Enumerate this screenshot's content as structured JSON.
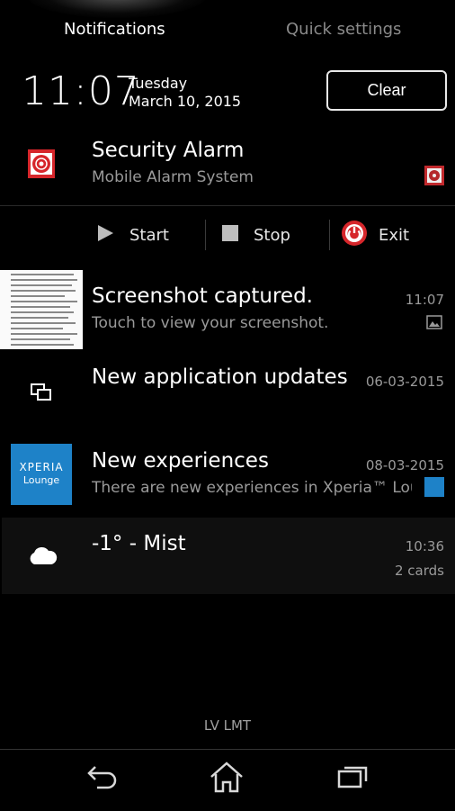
{
  "tabs": {
    "notifications": "Notifications",
    "quick_settings": "Quick settings"
  },
  "header": {
    "time": "11:07",
    "day": "Tuesday",
    "date": "March 10, 2015",
    "clear_label": "Clear"
  },
  "notifications": [
    {
      "title": "Security Alarm",
      "subtitle": "Mobile Alarm System",
      "icon": "alarm-icon"
    },
    {
      "title": "Screenshot captured.",
      "subtitle": "Touch to view your screenshot.",
      "time": "11:07",
      "icon": "screenshot-thumbnail"
    },
    {
      "title": "New application updates",
      "time": "06-03-2015",
      "icon": "updates-icon"
    },
    {
      "title": "New experiences",
      "subtitle": "There are new experiences in Xperia™ Lounge",
      "time": "08-03-2015",
      "icon": "xperia-lounge-icon",
      "icon_text": [
        "XPERIA",
        "Lounge"
      ]
    },
    {
      "title": "-1° - Mist",
      "time": "10:36",
      "extra": "2 cards",
      "icon": "cloud-icon"
    }
  ],
  "alarm_actions": [
    {
      "label": "Start",
      "icon": "play-icon"
    },
    {
      "label": "Stop",
      "icon": "stop-icon"
    },
    {
      "label": "Exit",
      "icon": "power-icon"
    }
  ],
  "footer": {
    "carrier": "LV LMT"
  },
  "navbar": {
    "back": "back-icon",
    "home": "home-icon",
    "recents": "recents-icon"
  },
  "colors": {
    "background": "#000000",
    "accent_red": "#d6262b",
    "xperia_blue": "#1e82c8",
    "muted_text": "#9a9a9a"
  }
}
